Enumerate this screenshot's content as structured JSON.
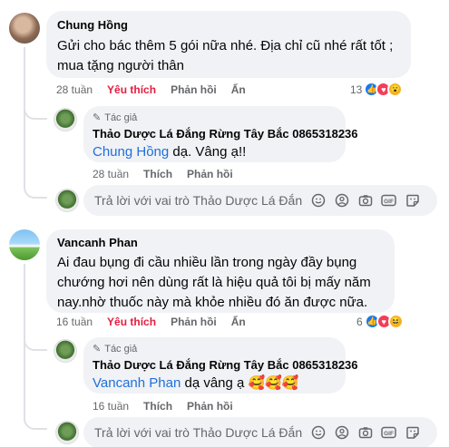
{
  "comment1": {
    "author": "Chung Hồng",
    "text_line1": "Gửi cho bác thêm 5 gói nữa nhé. Địa chỉ cũ nhé rất tốt ;",
    "text_line2": "mua tặng người thân",
    "time": "28 tuần",
    "like_label": "Yêu thích",
    "reply_label": "Phản hồi",
    "hide_label": "Ẩn",
    "reaction_count": "13",
    "reactions": [
      "like-icon",
      "love-icon",
      "wow-icon"
    ]
  },
  "reply1": {
    "badge": "Tác giả",
    "author": "Thảo Dược Lá Đắng Rừng Tây Bắc 0865318236",
    "mention": "Chung Hồng",
    "text": " dạ. Vâng ạ!!",
    "time": "28 tuần",
    "like_label": "Thích",
    "reply_label": "Phản hồi"
  },
  "replybox1": {
    "placeholder": "Trả lời với vai trò Thảo Dược Lá Đắn"
  },
  "comment2": {
    "author": "Vancanh Phan",
    "text_line1": "Ai đau bụng đi cầu nhiều lần trong ngày đầy bụng",
    "text_line2": "chướng hơi nên dùng rất là hiệu quả tôi bị mấy năm",
    "text_line3": "nay.nhờ thuốc này mà khỏe nhiều đó ăn được nữa.",
    "time": "16 tuần",
    "like_label": "Yêu thích",
    "reply_label": "Phản hồi",
    "hide_label": "Ẩn",
    "reaction_count": "6",
    "reactions": [
      "like-icon",
      "love-icon",
      "haha-icon"
    ]
  },
  "reply2": {
    "badge": "Tác giả",
    "author": "Thảo Dược Lá Đắng Rừng Tây Bắc 0865318236",
    "mention": "Vancanh Phan",
    "text": " dạ vâng ạ 🥰🥰🥰",
    "time": "16 tuần",
    "like_label": "Thích",
    "reply_label": "Phản hồi"
  },
  "replybox2": {
    "placeholder": "Trả lời với vai trò Thảo Dược Lá Đắn"
  },
  "colors": {
    "mention": "#216fdb",
    "love": "#e41e3f",
    "bubble": "#f0f2f5",
    "muted": "#65676b"
  }
}
